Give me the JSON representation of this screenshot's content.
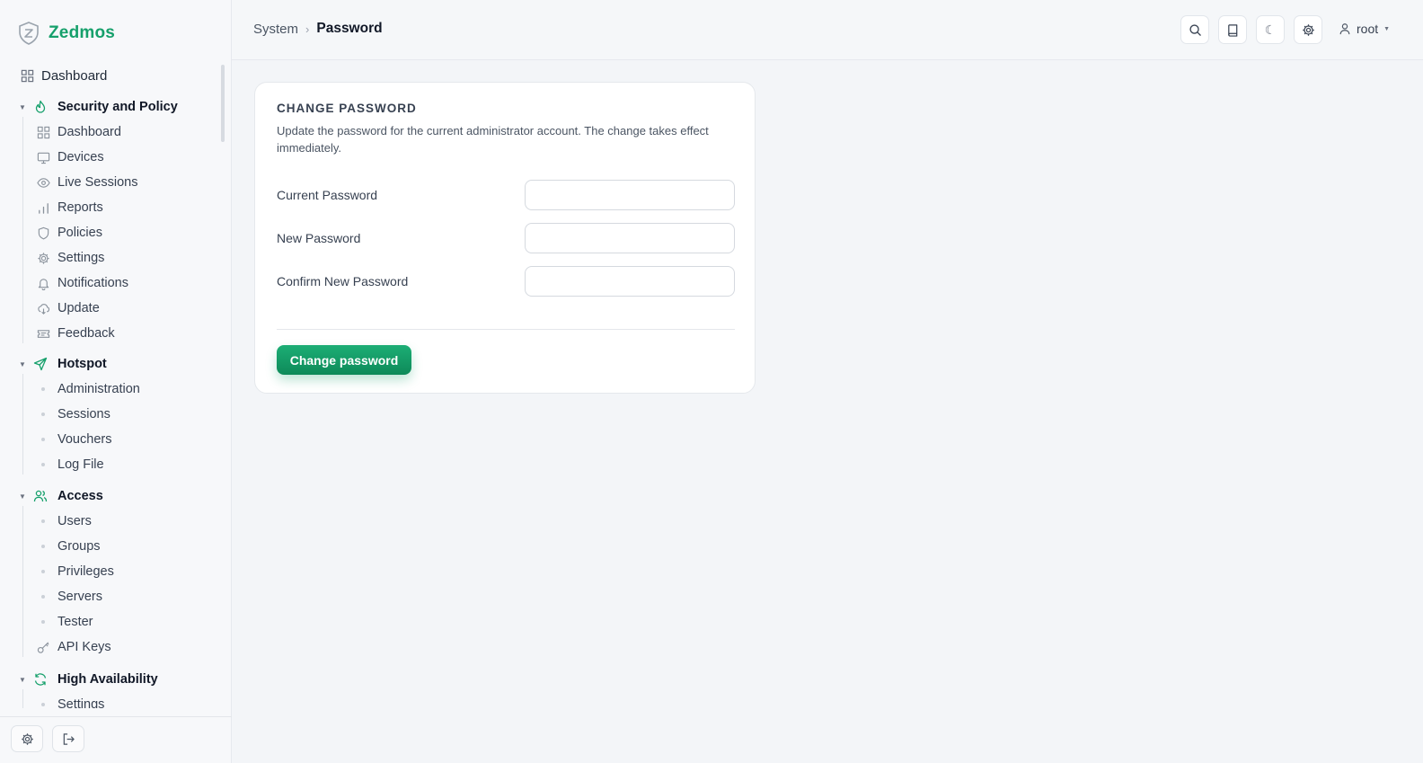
{
  "brand": {
    "name": "Zedmos"
  },
  "sidebar": {
    "top_item": {
      "label": "Dashboard",
      "icon": "dashboard-icon"
    },
    "groups": [
      {
        "label": "Security and Policy",
        "icon": "flame-icon",
        "items": [
          {
            "label": "Dashboard",
            "icon": "dashboard-icon"
          },
          {
            "label": "Devices",
            "icon": "monitor-icon"
          },
          {
            "label": "Live Sessions",
            "icon": "eye-icon"
          },
          {
            "label": "Reports",
            "icon": "bar-chart-icon"
          },
          {
            "label": "Policies",
            "icon": "shield-icon"
          },
          {
            "label": "Settings",
            "icon": "gear-icon"
          },
          {
            "label": "Notifications",
            "icon": "bell-icon"
          },
          {
            "label": "Update",
            "icon": "cloud-download-icon"
          },
          {
            "label": "Feedback",
            "icon": "ticket-icon"
          }
        ]
      },
      {
        "label": "Hotspot",
        "icon": "send-icon",
        "items": [
          {
            "label": "Administration"
          },
          {
            "label": "Sessions"
          },
          {
            "label": "Vouchers"
          },
          {
            "label": "Log File"
          }
        ]
      },
      {
        "label": "Access",
        "icon": "users-icon",
        "items": [
          {
            "label": "Users"
          },
          {
            "label": "Groups"
          },
          {
            "label": "Privileges"
          },
          {
            "label": "Servers"
          },
          {
            "label": "Tester"
          },
          {
            "label": "API Keys",
            "icon": "key-icon"
          }
        ]
      },
      {
        "label": "High Availability",
        "icon": "refresh-icon",
        "items": [
          {
            "label": "Settings"
          }
        ]
      }
    ]
  },
  "header": {
    "breadcrumb": {
      "parent": "System",
      "current": "Password"
    },
    "user": "root"
  },
  "card": {
    "title": "CHANGE PASSWORD",
    "description": "Update the password for the current administrator account. The change takes effect immediately.",
    "fields": [
      {
        "label": "Current Password",
        "value": ""
      },
      {
        "label": "New Password",
        "value": ""
      },
      {
        "label": "Confirm New Password",
        "value": ""
      }
    ],
    "submit_label": "Change password"
  },
  "colors": {
    "accent": "#16a06b",
    "background": "#f3f5f8"
  }
}
